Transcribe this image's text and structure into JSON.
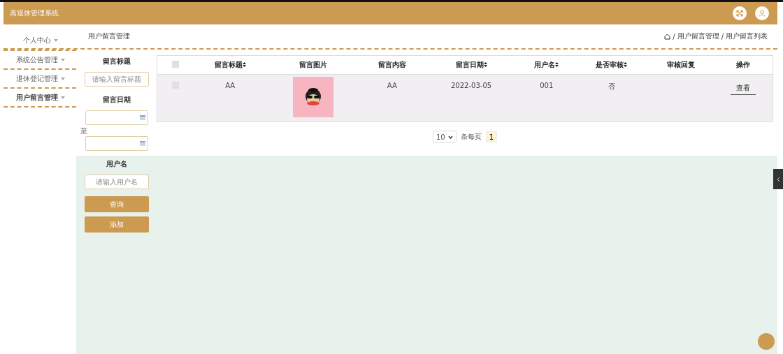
{
  "header": {
    "title": "高退休管理系统"
  },
  "sidebar": {
    "items": [
      {
        "label": "个人中心",
        "selected": false
      },
      {
        "label": "系统公告管理",
        "selected": false
      },
      {
        "label": "退休登记管理",
        "selected": false
      },
      {
        "label": "用户留言管理",
        "selected": true
      }
    ]
  },
  "page_title": "用户留言管理",
  "breadcrumb": {
    "separator": "/",
    "items": [
      "用户留言管理",
      "用户留言列表"
    ]
  },
  "filters": {
    "title_label": "留言标题",
    "title_placeholder": "请输入留言标题",
    "date_label": "留言日期",
    "date_separator": "至",
    "user_label": "用户名",
    "user_placeholder": "请输入用户名",
    "buttons": [
      "查询",
      "添加"
    ]
  },
  "table": {
    "select_all_checked": false,
    "columns": [
      {
        "label": "留言标题",
        "sortable": true
      },
      {
        "label": "留言图片",
        "sortable": false
      },
      {
        "label": "留言内容",
        "sortable": false
      },
      {
        "label": "留言日期",
        "sortable": true
      },
      {
        "label": "用户名",
        "sortable": true
      },
      {
        "label": "是否审核",
        "sortable": true
      },
      {
        "label": "审核回复",
        "sortable": false
      },
      {
        "label": "操作",
        "sortable": false
      }
    ],
    "rows": [
      {
        "checked": false,
        "title": "AA",
        "content": "AA",
        "date": "2022-03-05",
        "user": "001",
        "reviewed": "否",
        "action": "查看"
      }
    ]
  },
  "pagination": {
    "page_size": "10",
    "per_page_label": "条每页",
    "pages": [
      {
        "label": "1",
        "selected": true
      }
    ]
  }
}
